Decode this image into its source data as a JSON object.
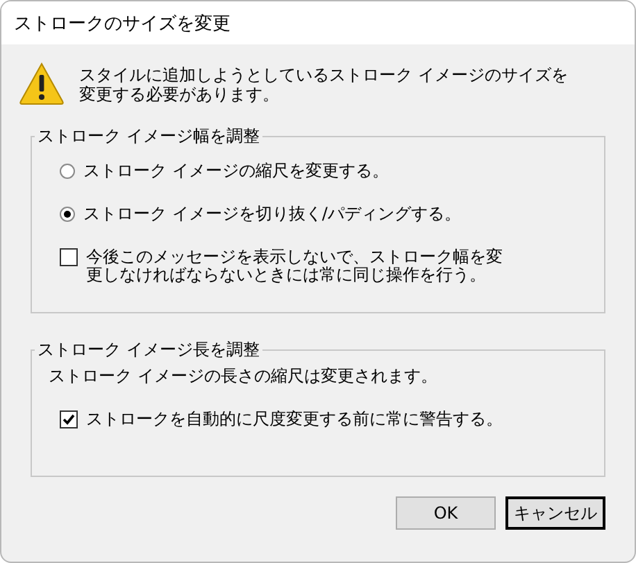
{
  "window": {
    "title": "ストロークのサイズを変更"
  },
  "message": "スタイルに追加しようとしているストローク イメージのサイズを変更する必要があります。",
  "width_group": {
    "title": "ストローク イメージ幅を調整",
    "options": [
      {
        "kind": "radio",
        "label": "ストローク イメージの縮尺を変更する。",
        "selected": false
      },
      {
        "kind": "radio",
        "label": "ストローク イメージを切り抜く/パディングする。",
        "selected": true
      },
      {
        "kind": "checkbox",
        "label": "今後このメッセージを表示しないで、ストローク幅を変更しなければならないときには常に同じ操作を行う。",
        "checked": false
      }
    ]
  },
  "length_group": {
    "title": "ストローク イメージ長を調整",
    "note": "ストローク イメージの長さの縮尺は変更されます。",
    "options": [
      {
        "kind": "checkbox",
        "label": "ストロークを自動的に尺度変更する前に常に警告する。",
        "checked": true
      }
    ]
  },
  "buttons": [
    {
      "label": "OK",
      "default": false
    },
    {
      "label": "キャンセル",
      "default": true
    }
  ]
}
